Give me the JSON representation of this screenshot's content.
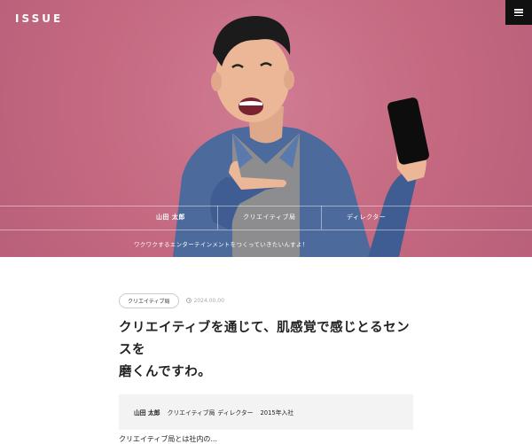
{
  "header": {
    "logo": "ISSUE",
    "menu_icon": "hamburger-icon"
  },
  "hero": {
    "background_color": "#c86d86",
    "name": "山田 太郎",
    "department": "クリエイティブ局",
    "role": "ディレクター",
    "quote": "ワクワクするエンターテインメントをつくっていきたいんすよ！"
  },
  "article": {
    "tag": "クリエイティブ局",
    "date": "2024.00.00",
    "date_icon": "clock-icon",
    "title_line1": "クリエイティブを通じて、肌感覚で感じとるセンスを",
    "title_line2": "磨くんですわ。",
    "profile": {
      "name": "山田 太郎",
      "department": "クリエイティブ局",
      "role": "ディレクター",
      "joined": "2015年入社"
    },
    "body_peek": "クリエイティブ局とは社内の..."
  }
}
